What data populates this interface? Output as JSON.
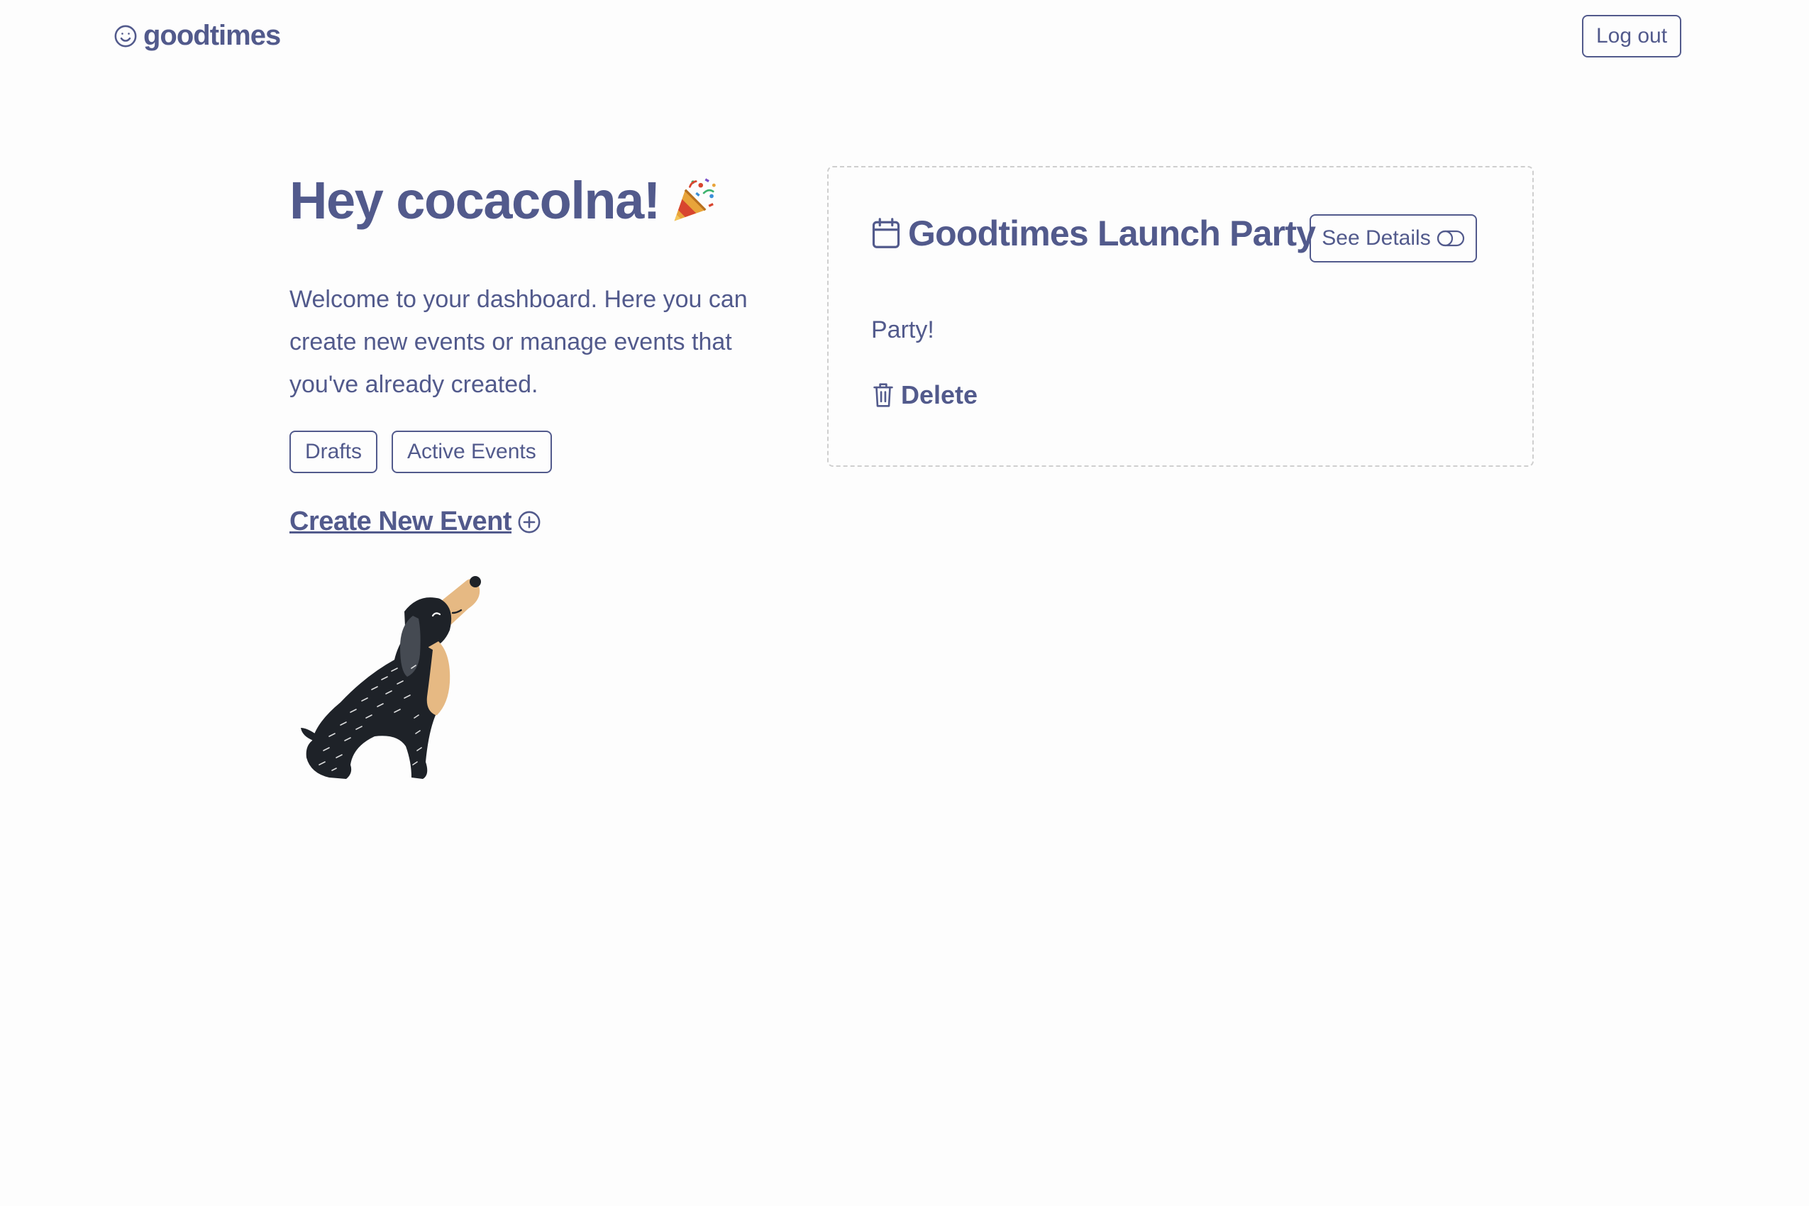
{
  "header": {
    "logo_text": "goodtimes",
    "logo_icon": "smiley-icon",
    "logout_label": "Log out"
  },
  "dashboard": {
    "greeting": "Hey cocacolna!",
    "greeting_icon": "party-popper-icon",
    "intro": "Welcome to your dashboard. Here you can create new events or manage events that you've already created.",
    "filters": [
      {
        "label": "Drafts"
      },
      {
        "label": "Active Events"
      }
    ],
    "create_label": "Create New Event",
    "create_icon": "plus-circle-icon",
    "illustration": "dog-illustration"
  },
  "event": {
    "icon": "calendar-icon",
    "title": "Goodtimes Launch Party",
    "details_label": "See Details",
    "details_icon": "toggle-icon",
    "description": "Party!",
    "delete_label": "Delete",
    "delete_icon": "trash-icon"
  },
  "colors": {
    "accent": "#525a8c",
    "background": "#fdfdfd",
    "card_border": "#cfcfcf",
    "dog_body": "#1e2228",
    "dog_ear_muzzle": "#e6b983"
  }
}
